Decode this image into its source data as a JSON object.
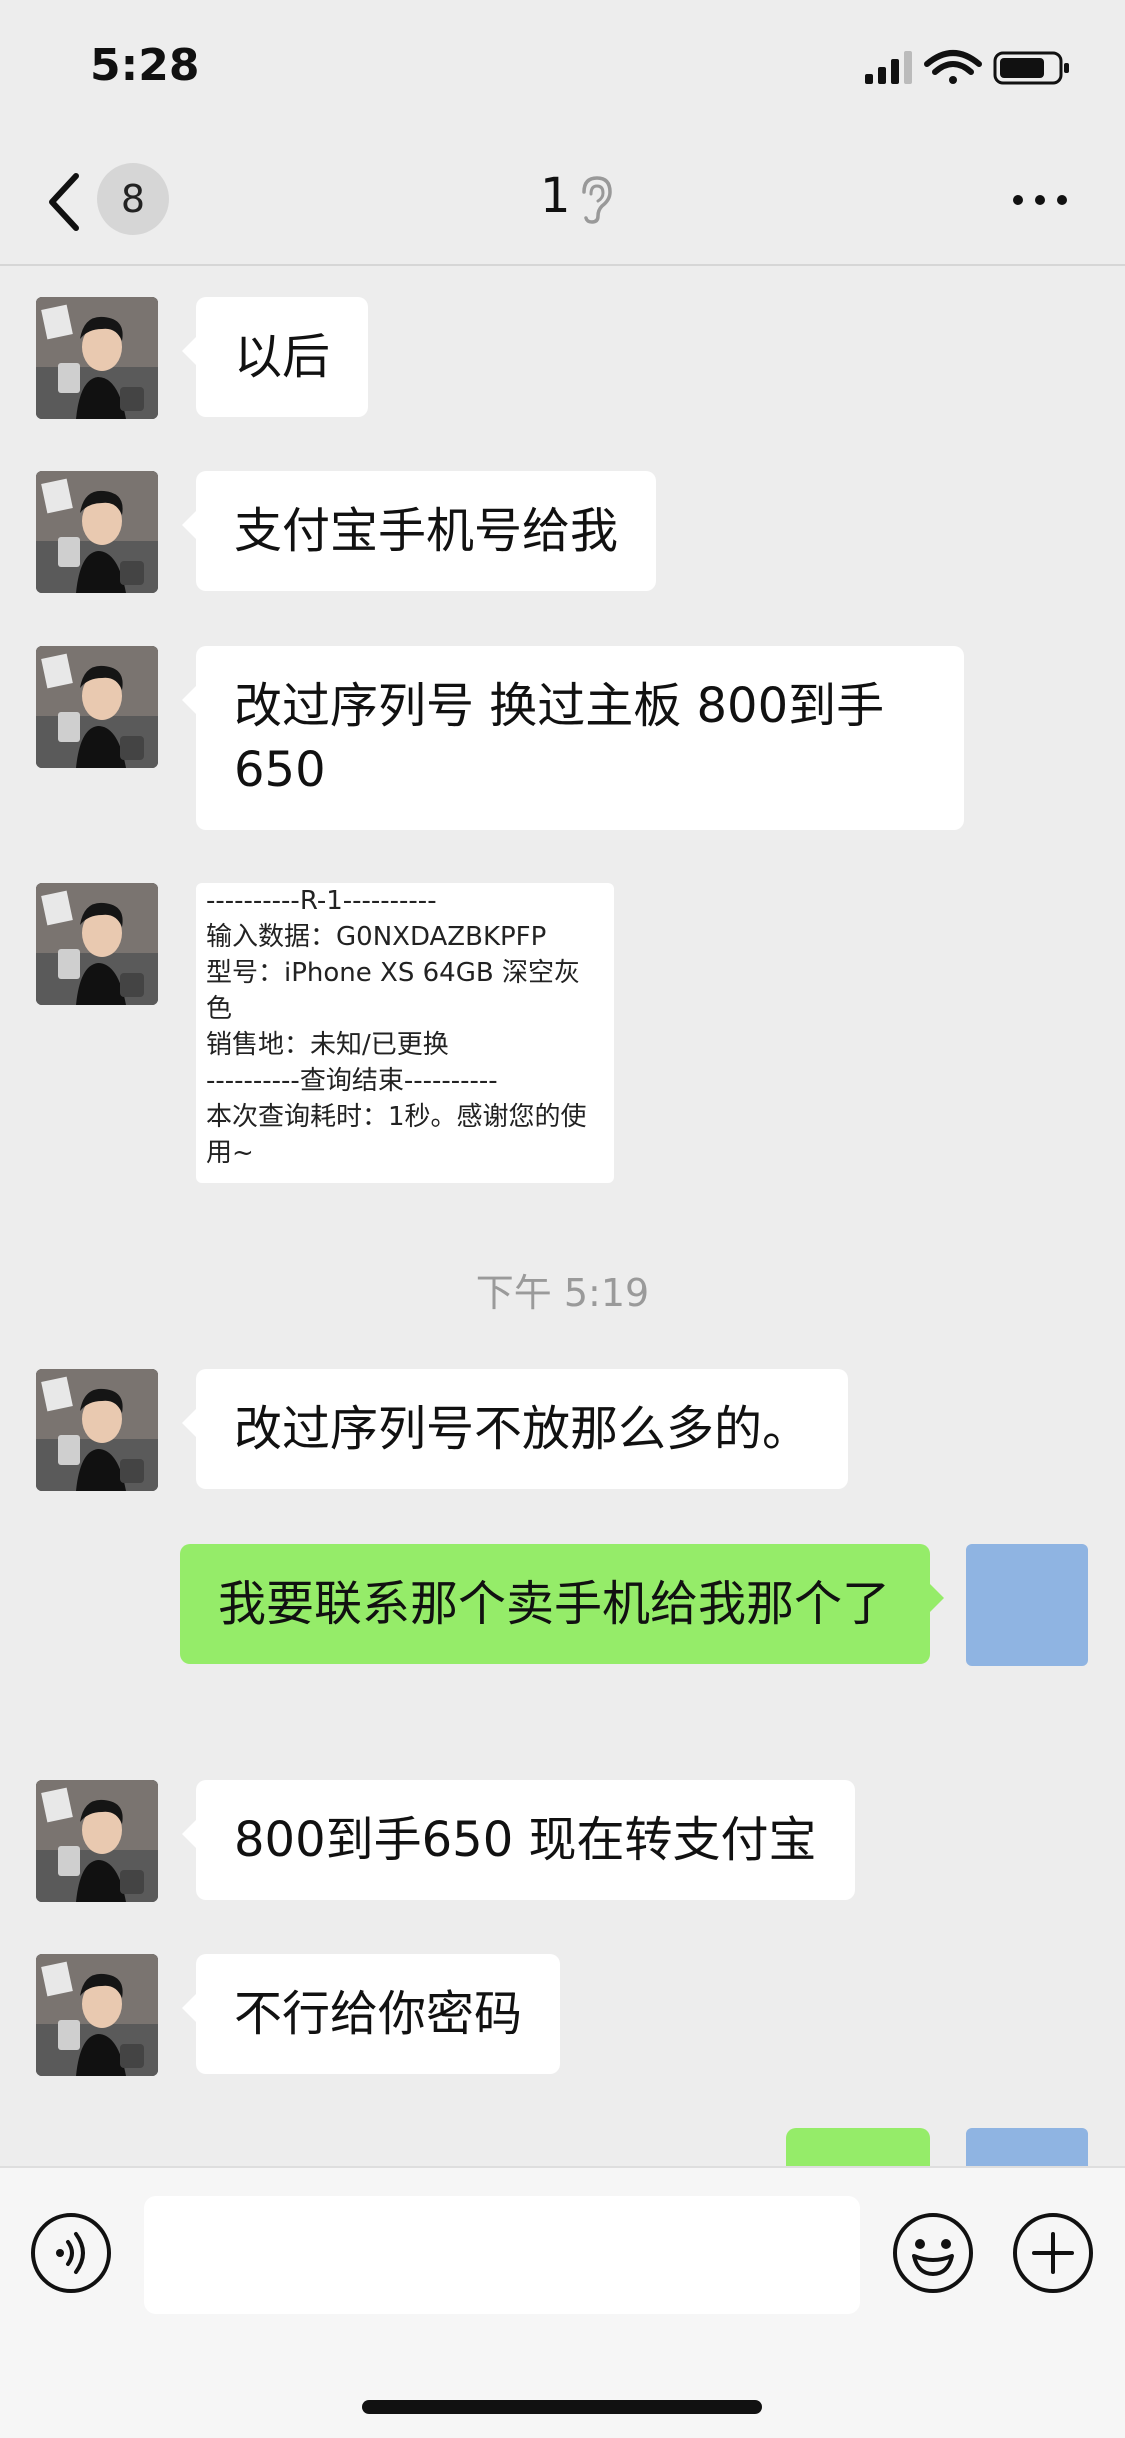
{
  "status_bar": {
    "time": "5:28"
  },
  "nav": {
    "badge": "8",
    "title": "1"
  },
  "messages": [
    {
      "text": "以后"
    },
    {
      "text": "支付宝手机号给我"
    },
    {
      "text": "改过序列号 换过主板 800到手650"
    },
    {
      "image_lines": [
        "----------R-1----------",
        "输入数据：G0NXDAZBKPFP",
        "型号：iPhone XS 64GB 深空灰色",
        "销售地：未知/已更换",
        "----------查询结束----------",
        "本次查询耗时：1秒。感谢您的使用~"
      ]
    },
    {
      "timestamp": "下午 5:19"
    },
    {
      "text": "改过序列号不放那么多的。"
    },
    {
      "text": "我要联系那个卖手机给我那个了"
    },
    {
      "text": "800到手650 现在转支付宝"
    },
    {
      "text": "不行给你密码"
    }
  ],
  "input": {
    "placeholder": ""
  },
  "colors": {
    "bg": "#ededed",
    "incoming": "#ffffff",
    "outgoing": "#95ec69",
    "self_avatar": "#8fb4e2"
  }
}
